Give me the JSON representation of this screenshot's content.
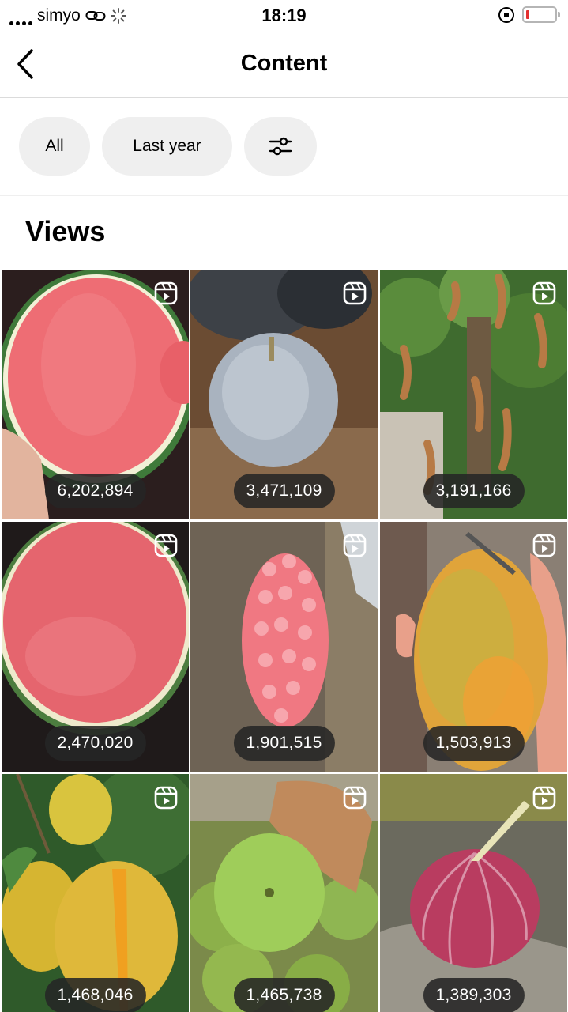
{
  "status_bar": {
    "carrier": "simyo",
    "time": "18:19",
    "icons": [
      "signal-dots-icon",
      "link-icon",
      "loading-spinner-icon",
      "rotation-lock-icon",
      "battery-low-icon"
    ]
  },
  "header": {
    "title": "Content",
    "back_icon": "chevron-left-icon"
  },
  "filters": {
    "all_label": "All",
    "period_label": "Last year",
    "settings_icon": "sliders-icon"
  },
  "section": {
    "title": "Views"
  },
  "colors": {
    "chip_bg": "#efefef",
    "pill_bg": "#262626",
    "battery_low": "#e3302f"
  },
  "posts": [
    {
      "views": "6,202,894",
      "type": "reel",
      "subject": "watermelon"
    },
    {
      "views": "3,471,109",
      "type": "reel",
      "subject": "frosted apple"
    },
    {
      "views": "3,191,166",
      "type": "reel",
      "subject": "tamarind tree"
    },
    {
      "views": "2,470,020",
      "type": "reel",
      "subject": "watermelon slice"
    },
    {
      "views": "1,901,515",
      "type": "reel",
      "subject": "pink berry cluster"
    },
    {
      "views": "1,503,913",
      "type": "reel",
      "subject": "mango"
    },
    {
      "views": "1,468,046",
      "type": "reel",
      "subject": "yellow mangoes"
    },
    {
      "views": "1,465,738",
      "type": "reel",
      "subject": "green mangoes"
    },
    {
      "views": "1,389,303",
      "type": "reel",
      "subject": "garlic bulb"
    }
  ]
}
